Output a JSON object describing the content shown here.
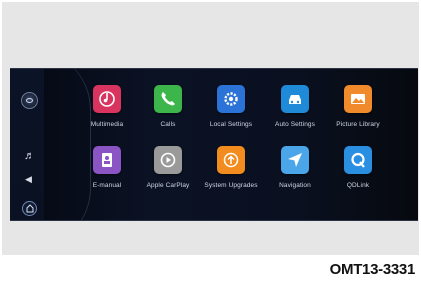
{
  "sidebar": {
    "items": [
      {
        "icon": "assistant-icon"
      },
      {
        "icon": "music-note-icon"
      },
      {
        "icon": "navigation-arrow-icon"
      },
      {
        "icon": "home-icon"
      }
    ]
  },
  "apps": [
    {
      "label": "Multimedia",
      "icon": "multimedia-icon",
      "color": "#d8345f"
    },
    {
      "label": "Calls",
      "icon": "phone-icon",
      "color": "#3cb64a"
    },
    {
      "label": "Local Settings",
      "icon": "gear-icon",
      "color": "#2b73d6"
    },
    {
      "label": "Auto Settings",
      "icon": "car-settings-icon",
      "color": "#1f8ad8"
    },
    {
      "label": "Picture Library",
      "icon": "picture-icon",
      "color": "#f08a2a"
    },
    {
      "label": "E-manual",
      "icon": "manual-icon",
      "color": "#8a54c4"
    },
    {
      "label": "Apple CarPlay",
      "icon": "carplay-icon",
      "color": "#9a9a9a"
    },
    {
      "label": "System Upgrades",
      "icon": "upgrade-icon",
      "color": "#f28c1e"
    },
    {
      "label": "Navigation",
      "icon": "navigation-icon",
      "color": "#4aa6e8"
    },
    {
      "label": "QDLink",
      "icon": "qdlink-icon",
      "color": "#2a8fe0"
    }
  ],
  "caption": "OMT13-3331"
}
